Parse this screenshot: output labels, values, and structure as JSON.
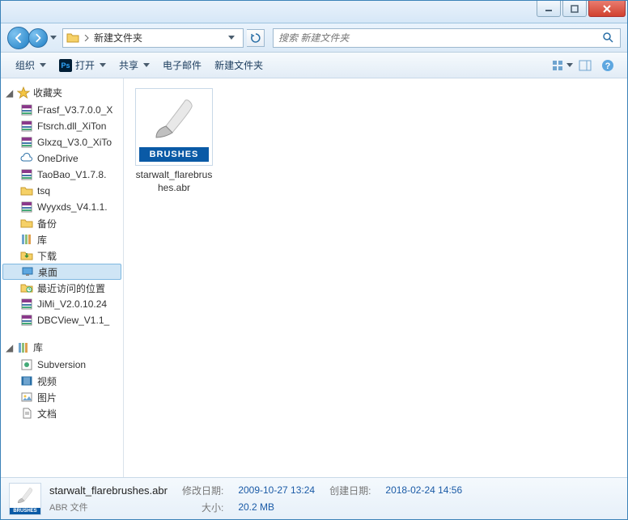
{
  "titlebar": {
    "minimize": "minimize",
    "maximize": "maximize",
    "close": "close"
  },
  "address": {
    "path": "新建文件夹",
    "search_placeholder": "搜索 新建文件夹"
  },
  "toolbar": {
    "organize": "组织",
    "open": "打开",
    "share": "共享",
    "email": "电子邮件",
    "newfolder": "新建文件夹"
  },
  "sidebar": {
    "favorites": "收藏夹",
    "fav_items": [
      "Frasf_V3.7.0.0_X",
      "Ftsrch.dll_XiTon",
      "Glxzq_V3.0_XiTo",
      "OneDrive",
      "TaoBao_V1.7.8.",
      "tsq",
      "Wyyxds_V4.1.1.",
      "备份",
      "库",
      "下载",
      "桌面",
      "最近访问的位置",
      "JiMi_V2.0.10.24",
      "DBCView_V1.1_"
    ],
    "selected_index": 10,
    "libraries": "库",
    "lib_items": [
      "Subversion",
      "视频",
      "图片",
      "文档"
    ]
  },
  "content": {
    "file": {
      "name": "starwalt_flarebrushes.abr",
      "band": "BRUSHES"
    }
  },
  "details": {
    "name": "starwalt_flarebrushes.abr",
    "type": "ABR 文件",
    "modified_label": "修改日期:",
    "modified": "2009-10-27 13:24",
    "size_label": "大小:",
    "size": "20.2 MB",
    "created_label": "创建日期:",
    "created": "2018-02-24 14:56"
  }
}
